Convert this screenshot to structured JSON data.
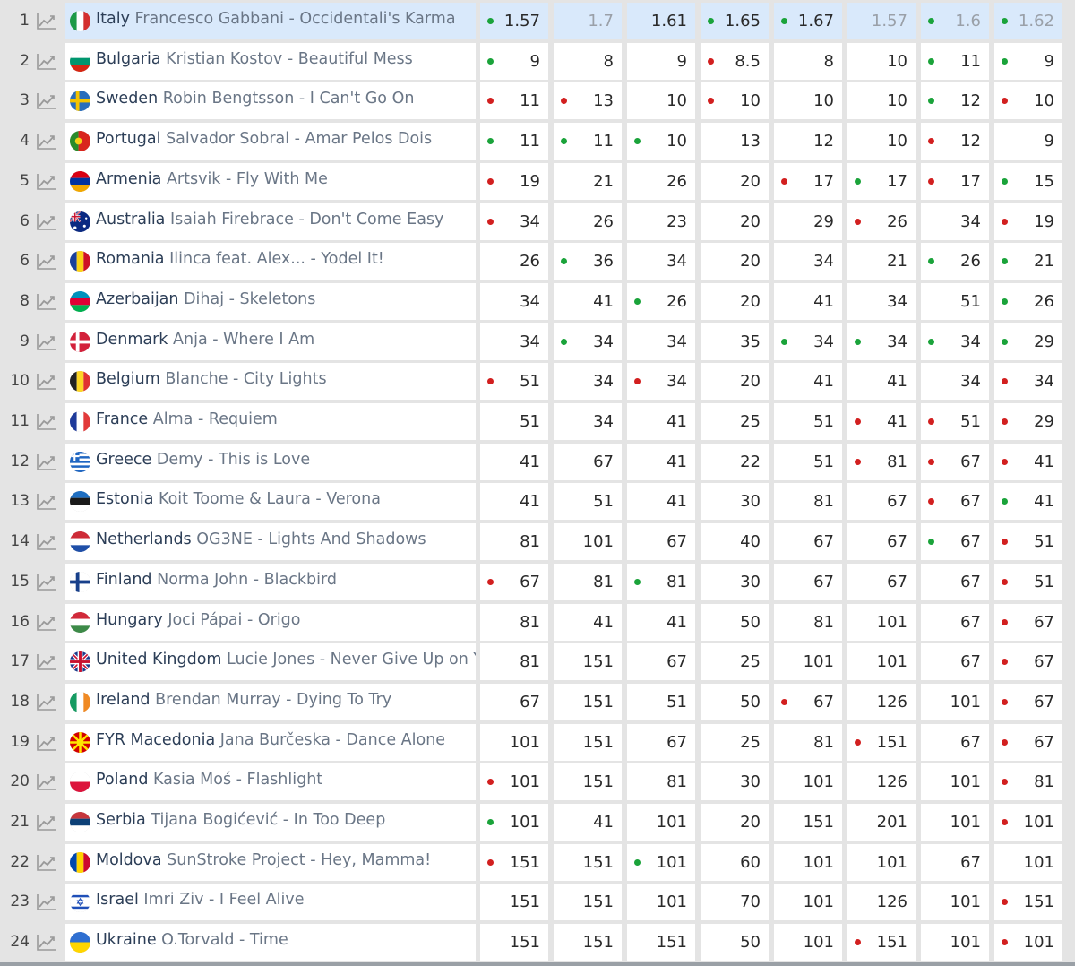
{
  "colors": {
    "up": "#1aa33a",
    "down": "#d21f1f",
    "highlight": "#d9e9fb"
  },
  "rows": [
    {
      "rank": "1",
      "country": "Italy",
      "entry": "Francesco Gabbani - Occidentali's Karma",
      "flag": "italy",
      "highlight": true,
      "odds": [
        {
          "v": "1.57",
          "d": "up"
        },
        {
          "v": "1.7",
          "d": ""
        },
        {
          "v": "1.61",
          "d": ""
        },
        {
          "v": "1.65",
          "d": "up"
        },
        {
          "v": "1.67",
          "d": "up"
        },
        {
          "v": "1.57",
          "d": ""
        },
        {
          "v": "1.6",
          "d": "up"
        },
        {
          "v": "1.62",
          "d": "up"
        }
      ]
    },
    {
      "rank": "2",
      "country": "Bulgaria",
      "entry": "Kristian Kostov - Beautiful Mess",
      "flag": "bulgaria",
      "odds": [
        {
          "v": "9",
          "d": "up"
        },
        {
          "v": "8",
          "d": ""
        },
        {
          "v": "9",
          "d": ""
        },
        {
          "v": "8.5",
          "d": "down"
        },
        {
          "v": "8",
          "d": ""
        },
        {
          "v": "10",
          "d": ""
        },
        {
          "v": "11",
          "d": "up"
        },
        {
          "v": "9",
          "d": "up"
        }
      ]
    },
    {
      "rank": "3",
      "country": "Sweden",
      "entry": "Robin Bengtsson - I Can't Go On",
      "flag": "sweden",
      "odds": [
        {
          "v": "11",
          "d": "down"
        },
        {
          "v": "13",
          "d": "down"
        },
        {
          "v": "10",
          "d": ""
        },
        {
          "v": "10",
          "d": "down"
        },
        {
          "v": "10",
          "d": ""
        },
        {
          "v": "10",
          "d": ""
        },
        {
          "v": "12",
          "d": "up"
        },
        {
          "v": "10",
          "d": "down"
        }
      ]
    },
    {
      "rank": "4",
      "country": "Portugal",
      "entry": "Salvador Sobral - Amar Pelos Dois",
      "flag": "portugal",
      "odds": [
        {
          "v": "11",
          "d": "up"
        },
        {
          "v": "11",
          "d": "up"
        },
        {
          "v": "10",
          "d": "up"
        },
        {
          "v": "13",
          "d": ""
        },
        {
          "v": "12",
          "d": ""
        },
        {
          "v": "10",
          "d": ""
        },
        {
          "v": "12",
          "d": "down"
        },
        {
          "v": "9",
          "d": ""
        }
      ]
    },
    {
      "rank": "5",
      "country": "Armenia",
      "entry": "Artsvik - Fly With Me",
      "flag": "armenia",
      "odds": [
        {
          "v": "19",
          "d": "down"
        },
        {
          "v": "21",
          "d": ""
        },
        {
          "v": "26",
          "d": ""
        },
        {
          "v": "20",
          "d": ""
        },
        {
          "v": "17",
          "d": "down"
        },
        {
          "v": "17",
          "d": "up"
        },
        {
          "v": "17",
          "d": "down"
        },
        {
          "v": "15",
          "d": "up"
        }
      ]
    },
    {
      "rank": "6",
      "country": "Australia",
      "entry": "Isaiah Firebrace - Don't Come Easy",
      "flag": "australia",
      "odds": [
        {
          "v": "34",
          "d": "down"
        },
        {
          "v": "26",
          "d": ""
        },
        {
          "v": "23",
          "d": ""
        },
        {
          "v": "20",
          "d": ""
        },
        {
          "v": "29",
          "d": ""
        },
        {
          "v": "26",
          "d": "down"
        },
        {
          "v": "34",
          "d": ""
        },
        {
          "v": "19",
          "d": "down"
        }
      ]
    },
    {
      "rank": "6",
      "country": "Romania",
      "entry": "Ilinca feat. Alex... - Yodel It!",
      "flag": "romania",
      "odds": [
        {
          "v": "26",
          "d": ""
        },
        {
          "v": "36",
          "d": "up"
        },
        {
          "v": "34",
          "d": ""
        },
        {
          "v": "20",
          "d": ""
        },
        {
          "v": "34",
          "d": ""
        },
        {
          "v": "21",
          "d": ""
        },
        {
          "v": "26",
          "d": "up"
        },
        {
          "v": "21",
          "d": "up"
        }
      ]
    },
    {
      "rank": "8",
      "country": "Azerbaijan",
      "entry": "Dihaj - Skeletons",
      "flag": "azerbaijan",
      "odds": [
        {
          "v": "34",
          "d": ""
        },
        {
          "v": "41",
          "d": ""
        },
        {
          "v": "26",
          "d": "up"
        },
        {
          "v": "20",
          "d": ""
        },
        {
          "v": "41",
          "d": ""
        },
        {
          "v": "34",
          "d": ""
        },
        {
          "v": "51",
          "d": ""
        },
        {
          "v": "26",
          "d": "up"
        }
      ]
    },
    {
      "rank": "9",
      "country": "Denmark",
      "entry": "Anja - Where I Am",
      "flag": "denmark",
      "odds": [
        {
          "v": "34",
          "d": ""
        },
        {
          "v": "34",
          "d": "up"
        },
        {
          "v": "34",
          "d": ""
        },
        {
          "v": "35",
          "d": ""
        },
        {
          "v": "34",
          "d": "up"
        },
        {
          "v": "34",
          "d": "up"
        },
        {
          "v": "34",
          "d": "up"
        },
        {
          "v": "29",
          "d": "up"
        }
      ]
    },
    {
      "rank": "10",
      "country": "Belgium",
      "entry": "Blanche - City Lights",
      "flag": "belgium",
      "odds": [
        {
          "v": "51",
          "d": "down"
        },
        {
          "v": "34",
          "d": ""
        },
        {
          "v": "34",
          "d": "down"
        },
        {
          "v": "20",
          "d": ""
        },
        {
          "v": "41",
          "d": ""
        },
        {
          "v": "41",
          "d": ""
        },
        {
          "v": "34",
          "d": ""
        },
        {
          "v": "34",
          "d": "down"
        }
      ]
    },
    {
      "rank": "11",
      "country": "France",
      "entry": "Alma - Requiem",
      "flag": "france",
      "odds": [
        {
          "v": "51",
          "d": ""
        },
        {
          "v": "34",
          "d": ""
        },
        {
          "v": "41",
          "d": ""
        },
        {
          "v": "25",
          "d": ""
        },
        {
          "v": "51",
          "d": ""
        },
        {
          "v": "41",
          "d": "down"
        },
        {
          "v": "51",
          "d": "down"
        },
        {
          "v": "29",
          "d": "down"
        }
      ]
    },
    {
      "rank": "12",
      "country": "Greece",
      "entry": "Demy - This is Love",
      "flag": "greece",
      "odds": [
        {
          "v": "41",
          "d": ""
        },
        {
          "v": "67",
          "d": ""
        },
        {
          "v": "41",
          "d": ""
        },
        {
          "v": "22",
          "d": ""
        },
        {
          "v": "51",
          "d": ""
        },
        {
          "v": "81",
          "d": "down"
        },
        {
          "v": "67",
          "d": "down"
        },
        {
          "v": "41",
          "d": "down"
        }
      ]
    },
    {
      "rank": "13",
      "country": "Estonia",
      "entry": "Koit Toome & Laura - Verona",
      "flag": "estonia",
      "odds": [
        {
          "v": "41",
          "d": ""
        },
        {
          "v": "51",
          "d": ""
        },
        {
          "v": "41",
          "d": ""
        },
        {
          "v": "30",
          "d": ""
        },
        {
          "v": "81",
          "d": ""
        },
        {
          "v": "67",
          "d": ""
        },
        {
          "v": "67",
          "d": "down"
        },
        {
          "v": "41",
          "d": "up"
        }
      ]
    },
    {
      "rank": "14",
      "country": "Netherlands",
      "entry": "OG3NE - Lights And Shadows",
      "flag": "netherlands",
      "odds": [
        {
          "v": "81",
          "d": ""
        },
        {
          "v": "101",
          "d": ""
        },
        {
          "v": "67",
          "d": ""
        },
        {
          "v": "40",
          "d": ""
        },
        {
          "v": "67",
          "d": ""
        },
        {
          "v": "67",
          "d": ""
        },
        {
          "v": "67",
          "d": "up"
        },
        {
          "v": "51",
          "d": "down"
        }
      ]
    },
    {
      "rank": "15",
      "country": "Finland",
      "entry": "Norma John - Blackbird",
      "flag": "finland",
      "odds": [
        {
          "v": "67",
          "d": "down"
        },
        {
          "v": "81",
          "d": ""
        },
        {
          "v": "81",
          "d": "up"
        },
        {
          "v": "30",
          "d": ""
        },
        {
          "v": "67",
          "d": ""
        },
        {
          "v": "67",
          "d": ""
        },
        {
          "v": "67",
          "d": ""
        },
        {
          "v": "51",
          "d": "down"
        }
      ]
    },
    {
      "rank": "16",
      "country": "Hungary",
      "entry": "Joci Pápai - Origo",
      "flag": "hungary",
      "odds": [
        {
          "v": "81",
          "d": ""
        },
        {
          "v": "41",
          "d": ""
        },
        {
          "v": "41",
          "d": ""
        },
        {
          "v": "50",
          "d": ""
        },
        {
          "v": "81",
          "d": ""
        },
        {
          "v": "101",
          "d": ""
        },
        {
          "v": "67",
          "d": ""
        },
        {
          "v": "67",
          "d": "down"
        }
      ]
    },
    {
      "rank": "17",
      "country": "United Kingdom",
      "entry": "Lucie Jones - Never Give Up on Yo",
      "flag": "uk",
      "odds": [
        {
          "v": "81",
          "d": ""
        },
        {
          "v": "151",
          "d": ""
        },
        {
          "v": "67",
          "d": ""
        },
        {
          "v": "25",
          "d": ""
        },
        {
          "v": "101",
          "d": ""
        },
        {
          "v": "101",
          "d": ""
        },
        {
          "v": "67",
          "d": ""
        },
        {
          "v": "67",
          "d": "down"
        }
      ]
    },
    {
      "rank": "18",
      "country": "Ireland",
      "entry": "Brendan Murray - Dying To Try",
      "flag": "ireland",
      "odds": [
        {
          "v": "67",
          "d": ""
        },
        {
          "v": "151",
          "d": ""
        },
        {
          "v": "51",
          "d": ""
        },
        {
          "v": "50",
          "d": ""
        },
        {
          "v": "67",
          "d": "down"
        },
        {
          "v": "126",
          "d": ""
        },
        {
          "v": "101",
          "d": ""
        },
        {
          "v": "67",
          "d": "down"
        }
      ]
    },
    {
      "rank": "19",
      "country": "FYR Macedonia",
      "entry": "Jana Burčeska - Dance Alone",
      "flag": "macedonia",
      "odds": [
        {
          "v": "101",
          "d": ""
        },
        {
          "v": "151",
          "d": ""
        },
        {
          "v": "67",
          "d": ""
        },
        {
          "v": "25",
          "d": ""
        },
        {
          "v": "81",
          "d": ""
        },
        {
          "v": "151",
          "d": "down"
        },
        {
          "v": "67",
          "d": ""
        },
        {
          "v": "67",
          "d": "down"
        }
      ]
    },
    {
      "rank": "20",
      "country": "Poland",
      "entry": "Kasia Moś - Flashlight",
      "flag": "poland",
      "odds": [
        {
          "v": "101",
          "d": "down"
        },
        {
          "v": "151",
          "d": ""
        },
        {
          "v": "81",
          "d": ""
        },
        {
          "v": "30",
          "d": ""
        },
        {
          "v": "101",
          "d": ""
        },
        {
          "v": "126",
          "d": ""
        },
        {
          "v": "101",
          "d": ""
        },
        {
          "v": "81",
          "d": "down"
        }
      ]
    },
    {
      "rank": "21",
      "country": "Serbia",
      "entry": "Tijana Bogićević - In Too Deep",
      "flag": "serbia",
      "odds": [
        {
          "v": "101",
          "d": "up"
        },
        {
          "v": "41",
          "d": ""
        },
        {
          "v": "101",
          "d": ""
        },
        {
          "v": "20",
          "d": ""
        },
        {
          "v": "151",
          "d": ""
        },
        {
          "v": "201",
          "d": ""
        },
        {
          "v": "101",
          "d": ""
        },
        {
          "v": "101",
          "d": "down"
        }
      ]
    },
    {
      "rank": "22",
      "country": "Moldova",
      "entry": "SunStroke Project - Hey, Mamma!",
      "flag": "moldova",
      "odds": [
        {
          "v": "151",
          "d": "down"
        },
        {
          "v": "151",
          "d": ""
        },
        {
          "v": "101",
          "d": "up"
        },
        {
          "v": "60",
          "d": ""
        },
        {
          "v": "101",
          "d": ""
        },
        {
          "v": "101",
          "d": ""
        },
        {
          "v": "67",
          "d": ""
        },
        {
          "v": "101",
          "d": ""
        }
      ]
    },
    {
      "rank": "23",
      "country": "Israel",
      "entry": "Imri Ziv - I Feel Alive",
      "flag": "israel",
      "odds": [
        {
          "v": "151",
          "d": ""
        },
        {
          "v": "151",
          "d": ""
        },
        {
          "v": "101",
          "d": ""
        },
        {
          "v": "70",
          "d": ""
        },
        {
          "v": "101",
          "d": ""
        },
        {
          "v": "126",
          "d": ""
        },
        {
          "v": "101",
          "d": ""
        },
        {
          "v": "151",
          "d": "down"
        }
      ]
    },
    {
      "rank": "24",
      "country": "Ukraine",
      "entry": "O.Torvald - Time",
      "flag": "ukraine",
      "odds": [
        {
          "v": "151",
          "d": ""
        },
        {
          "v": "151",
          "d": ""
        },
        {
          "v": "151",
          "d": ""
        },
        {
          "v": "50",
          "d": ""
        },
        {
          "v": "101",
          "d": ""
        },
        {
          "v": "151",
          "d": "down"
        },
        {
          "v": "101",
          "d": ""
        },
        {
          "v": "101",
          "d": "down"
        }
      ]
    }
  ]
}
